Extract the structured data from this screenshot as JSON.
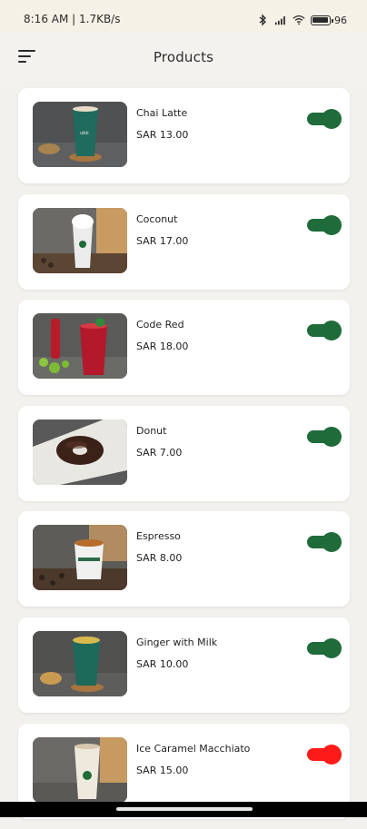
{
  "status_bar": {
    "time": "8:16 AM | 1.7KB/s",
    "battery_text": "96"
  },
  "header": {
    "title": "Products"
  },
  "colors": {
    "toggle_on": "#1f6b3a",
    "toggle_off": "#ff1a1a"
  },
  "products": [
    {
      "name": "Chai Latte",
      "price": "SAR 13.00",
      "enabled": true
    },
    {
      "name": "Coconut",
      "price": "SAR 17.00",
      "enabled": true
    },
    {
      "name": "Code Red",
      "price": "SAR 18.00",
      "enabled": true
    },
    {
      "name": "Donut",
      "price": "SAR 7.00",
      "enabled": true
    },
    {
      "name": "Espresso",
      "price": "SAR 8.00",
      "enabled": true
    },
    {
      "name": "Ginger with Milk",
      "price": "SAR 10.00",
      "enabled": true
    },
    {
      "name": "Ice Caramel Macchiato",
      "price": "SAR 15.00",
      "enabled": false
    }
  ]
}
